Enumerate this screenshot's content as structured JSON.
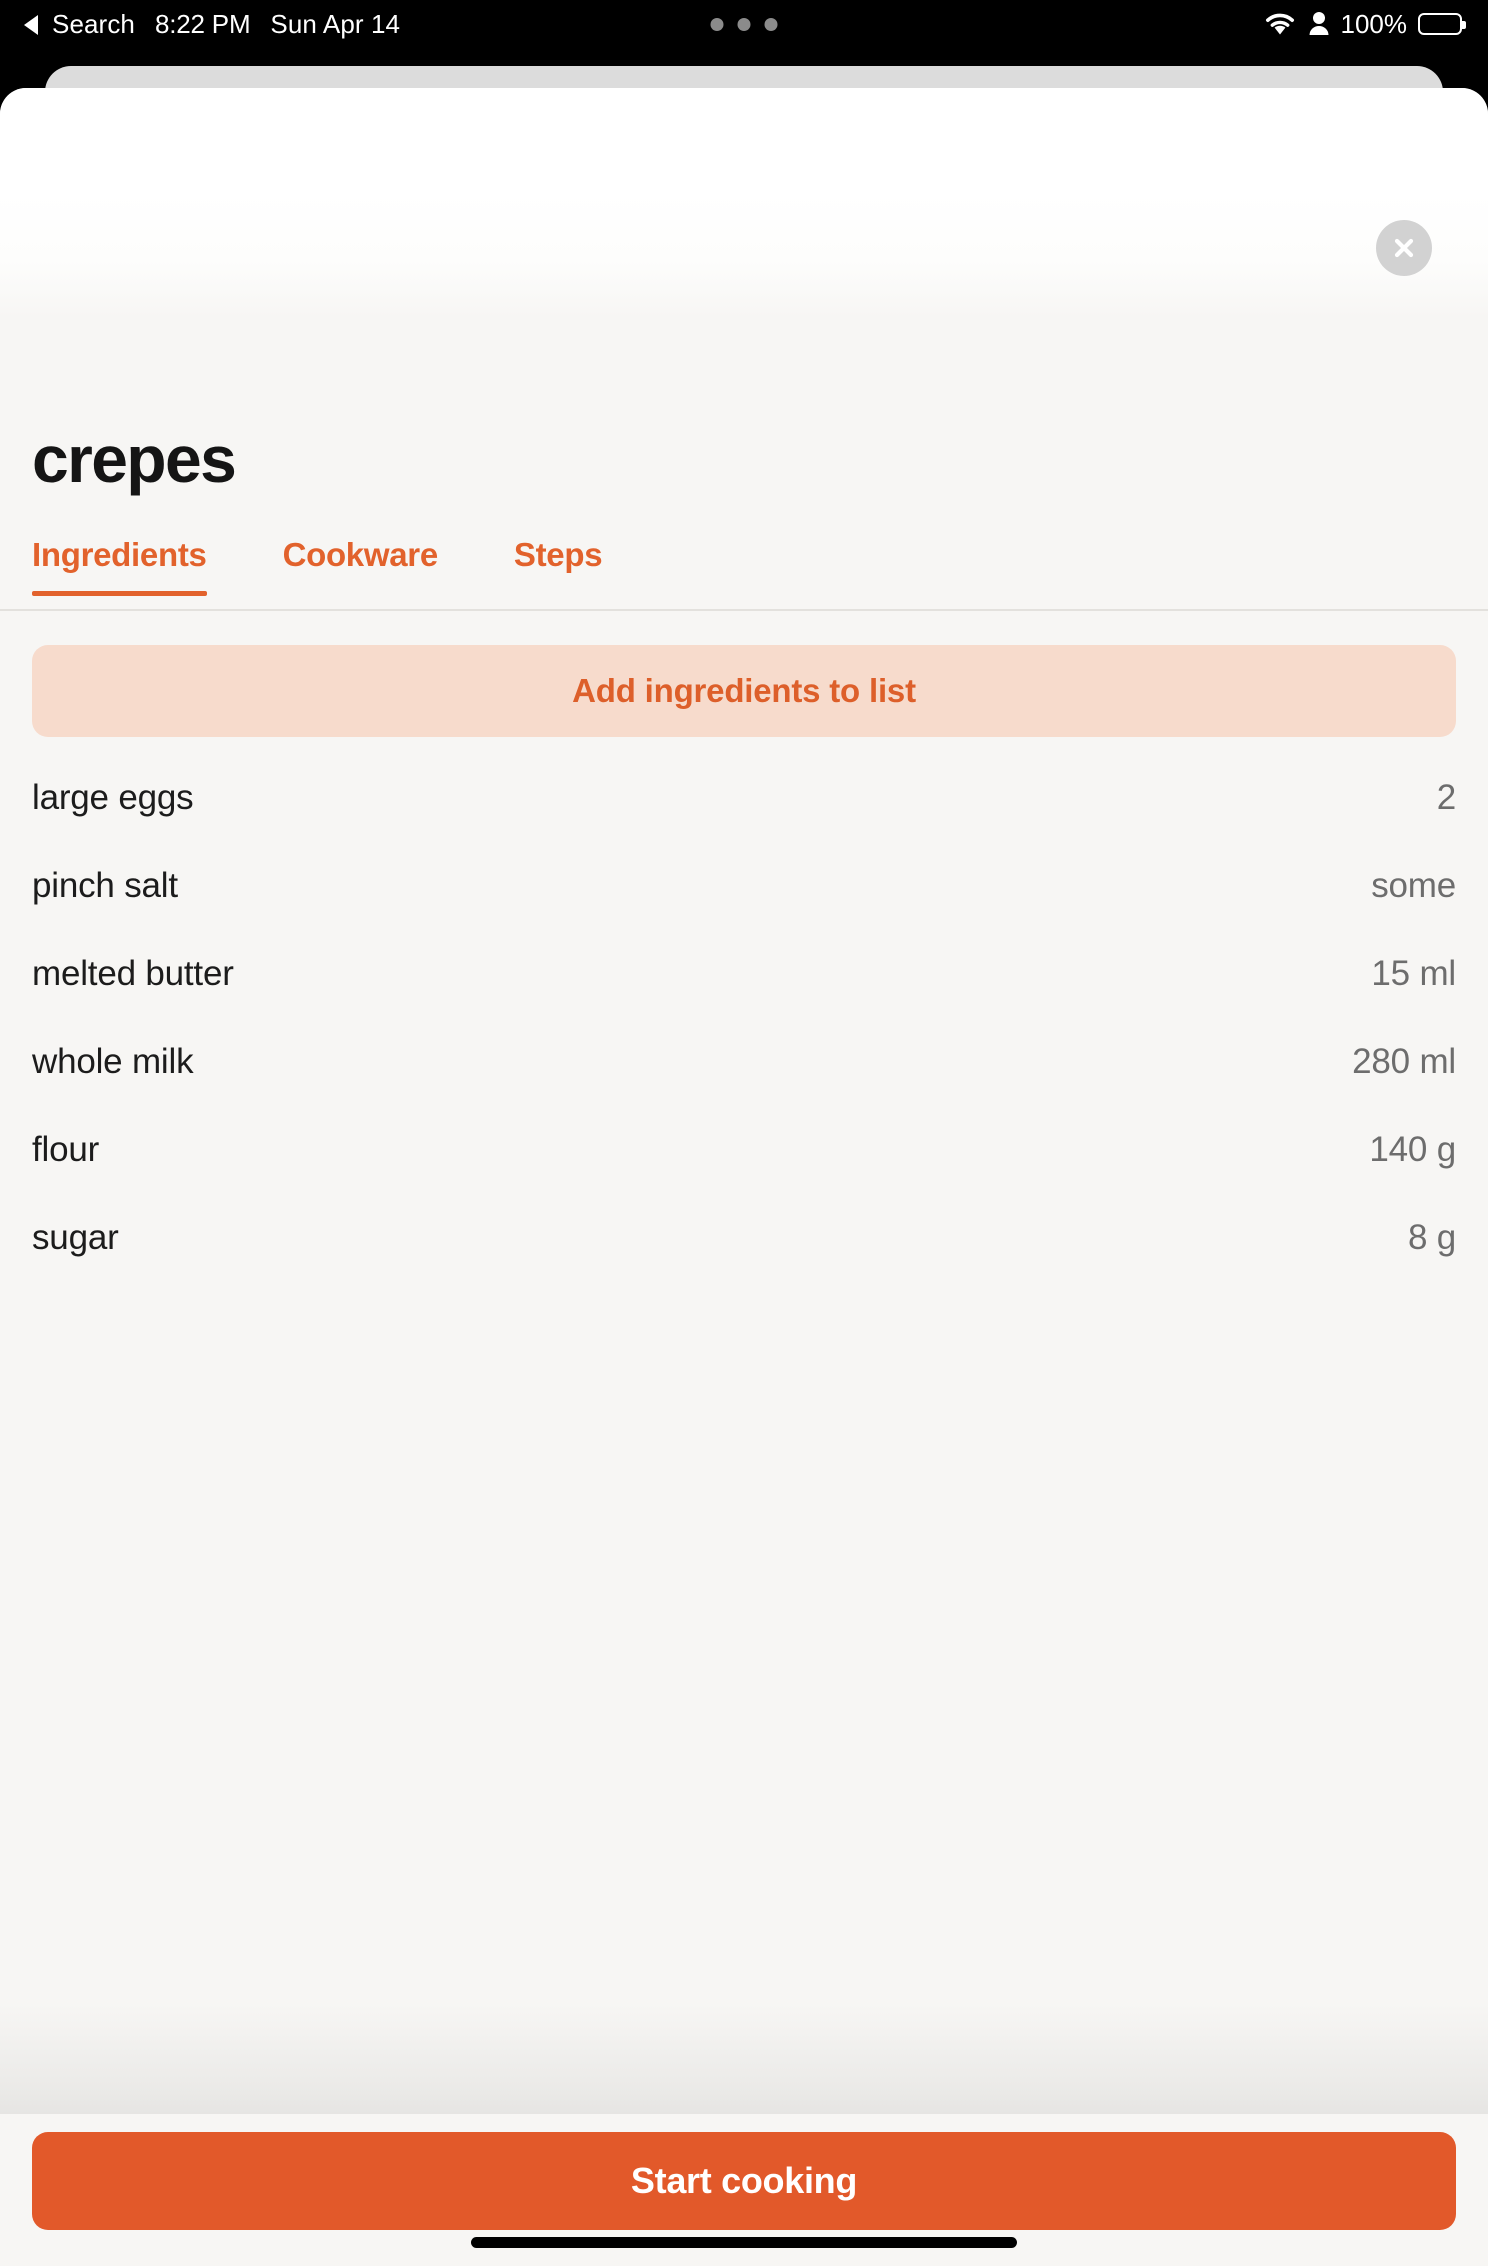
{
  "status_bar": {
    "back_label": "Search",
    "time": "8:22 PM",
    "date": "Sun Apr 14",
    "battery_percent": "100%",
    "icons": [
      "back-triangle-icon",
      "wifi-icon",
      "person-icon",
      "battery-icon"
    ],
    "multitask_dots": 3
  },
  "sheet": {
    "close_icon": "close-icon",
    "title": "crepes"
  },
  "tabs": [
    {
      "label": "Ingredients",
      "active": true
    },
    {
      "label": "Cookware",
      "active": false
    },
    {
      "label": "Steps",
      "active": false
    }
  ],
  "actions": {
    "add_ingredients_label": "Add ingredients to list",
    "start_cooking_label": "Start cooking"
  },
  "ingredients": [
    {
      "name": "large eggs",
      "qty": "2"
    },
    {
      "name": "pinch salt",
      "qty": "some"
    },
    {
      "name": "melted butter",
      "qty": "15 ml"
    },
    {
      "name": "whole milk",
      "qty": "280 ml"
    },
    {
      "name": "flour",
      "qty": "140 g"
    },
    {
      "name": "sugar",
      "qty": "8 g"
    }
  ],
  "colors": {
    "accent_orange": "#e2622c",
    "accent_orange_solid": "#e2592a",
    "accent_orange_soft": "#f7dbcc",
    "sheet_bg": "#f7f6f4",
    "text_primary": "#1c1c1c",
    "text_secondary": "#6d6d6d"
  }
}
